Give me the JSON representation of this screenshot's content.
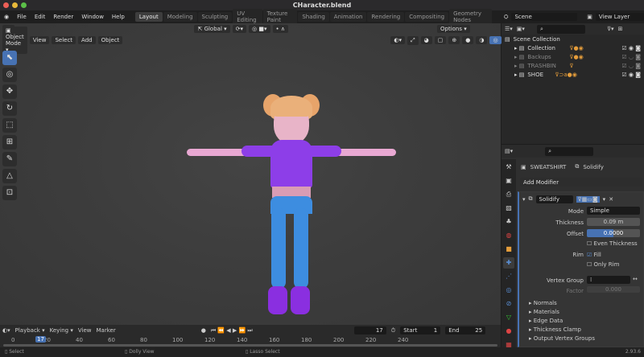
{
  "window": {
    "title": "CHaracter.blend"
  },
  "menu": [
    "File",
    "Edit",
    "Render",
    "Window",
    "Help"
  ],
  "workspaces": [
    "Layout",
    "Modeling",
    "Sculpting",
    "UV Editing",
    "Texture Paint",
    "Shading",
    "Animation",
    "Rendering",
    "Compositing",
    "Geometry Nodes"
  ],
  "scene": "Scene",
  "view_layer": "View Layer",
  "viewport": {
    "orientation": "Global",
    "mode": "Object Mode",
    "menus": [
      "View",
      "Select",
      "Add",
      "Object"
    ],
    "options": "Options"
  },
  "outliner": {
    "root": "Scene Collection",
    "items": [
      {
        "name": "Collection",
        "dim": false
      },
      {
        "name": "Backups",
        "dim": true
      },
      {
        "name": "TRASHBIN",
        "dim": true
      },
      {
        "name": "SHOE",
        "dim": false
      }
    ]
  },
  "properties": {
    "object": "SWEATSHIRT",
    "modifier_breadcrumb": "Solidify",
    "add_modifier": "Add Modifier",
    "modifier_name": "Solidify",
    "mode_label": "Mode",
    "mode": "Simple",
    "thickness_label": "Thickness",
    "thickness": "0.09 m",
    "offset_label": "Offset",
    "offset": "0.0000",
    "offset_fill": 0.5,
    "even_thickness": "Even Thickness",
    "rim_label": "Rim",
    "fill": "Fill",
    "only_rim": "Only Rim",
    "vertex_group_label": "Vertex Group",
    "factor_label": "Factor",
    "factor": "0.000",
    "sections": [
      "Normals",
      "Materials",
      "Edge Data",
      "Thickness Clamp",
      "Output Vertex Groups"
    ]
  },
  "timeline": {
    "menus": [
      "Playback",
      "Keying",
      "View",
      "Marker"
    ],
    "current_frame": "17",
    "start_label": "Start",
    "start": "1",
    "end_label": "End",
    "end": "25",
    "ticks": [
      "0",
      "20",
      "40",
      "60",
      "80",
      "100",
      "120",
      "140",
      "160",
      "180",
      "200",
      "220",
      "240"
    ]
  },
  "status": {
    "select": "Select",
    "dolly": "Dolly View",
    "lasso": "Lasso Select",
    "version": "2.93.6"
  }
}
